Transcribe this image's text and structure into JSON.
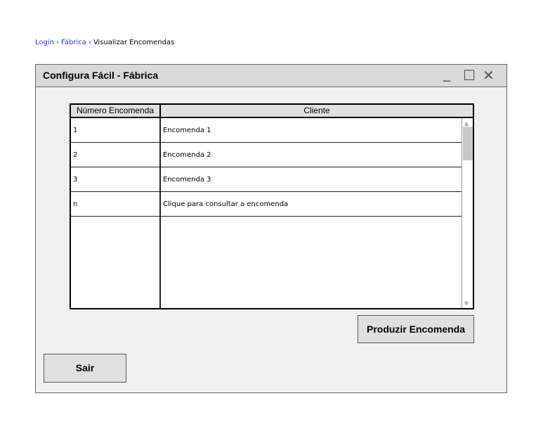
{
  "breadcrumb": {
    "items": [
      "Login",
      "Fábrica",
      "Visualizar Encomendas"
    ],
    "separator": "›"
  },
  "window": {
    "title": "Configura Fácil - Fábrica",
    "controls": {
      "minimize": "_",
      "maximize": "☐",
      "close": "✕"
    }
  },
  "table": {
    "headers": [
      "Número Encomenda",
      "Cliente"
    ],
    "rows": [
      [
        "1",
        "Encomenda 1"
      ],
      [
        "2",
        "Encomenda 2"
      ],
      [
        "3",
        "Encomenda 3"
      ],
      [
        "n",
        "Clique para consultar a encomenda"
      ]
    ],
    "scroll": {
      "up": "▲",
      "down": "▼"
    }
  },
  "buttons": {
    "produce": "Produzir Encomenda",
    "exit": "Sair"
  }
}
